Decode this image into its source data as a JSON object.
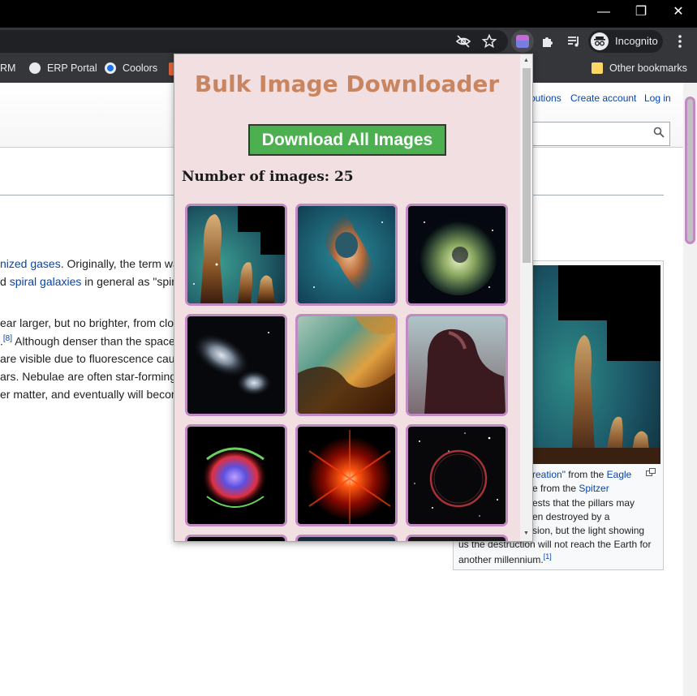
{
  "browser": {
    "window_controls": [
      "—",
      "❐",
      "✕"
    ],
    "incognito_label": "Incognito",
    "bookmarks": [
      {
        "label": "RM",
        "color": ""
      },
      {
        "label": "ERP Portal",
        "color": "#e8eaed"
      },
      {
        "label": "Coolors",
        "color": "#1a73e8"
      }
    ],
    "other_bookmarks": "Other bookmarks"
  },
  "wiki": {
    "top_links": [
      "butions",
      "Create account",
      "Log in"
    ],
    "paragraph": {
      "l1_link": "nized gases",
      "l1_text": ". Originally, the term wa",
      "l2_pre": "d ",
      "l2_link": "spiral galaxies",
      "l2_text": " in general as \"spira",
      "l3": "ear larger, but no brighter, from clo",
      "l4_pre": ".",
      "l4_ref": "[8]",
      "l4_text": " Although denser than the space",
      "l5": "are visible due to fluorescence caus",
      "l6": "ars. Nebulae are often star-forming",
      "l7": "er matter, and eventually will becor"
    },
    "caption": {
      "l1_link1": "reation\"",
      "l1_text": " from the ",
      "l1_link2": "Eagle",
      "l2_text": "e from the ",
      "l2_link": "Spitzer",
      "l3": "ests that the pillars may",
      "l4": "en destroyed by a",
      "l5": "sion, but the light showing",
      "l6": "us the destruction will not reach the Earth for",
      "l7": "another millennium.",
      "l7_ref": "[1]"
    }
  },
  "popup": {
    "title": "Bulk Image Downloader",
    "download_button": "Download All Images",
    "count_label": "Number of images: ",
    "count": 25
  },
  "images": [
    "pillars-of-creation",
    "carina-nebula",
    "tarantula-nebula",
    "galaxy-pair",
    "eagle-nebula-closeup",
    "horsehead-nebula",
    "cats-eye-nebula",
    "red-rectangle-nebula",
    "supernova-remnant-shell"
  ],
  "colors": {
    "popup_bg": "#f2dfe2",
    "title": "#c98560",
    "button": "#4caf50",
    "thumb_border": "#c08ac2"
  }
}
